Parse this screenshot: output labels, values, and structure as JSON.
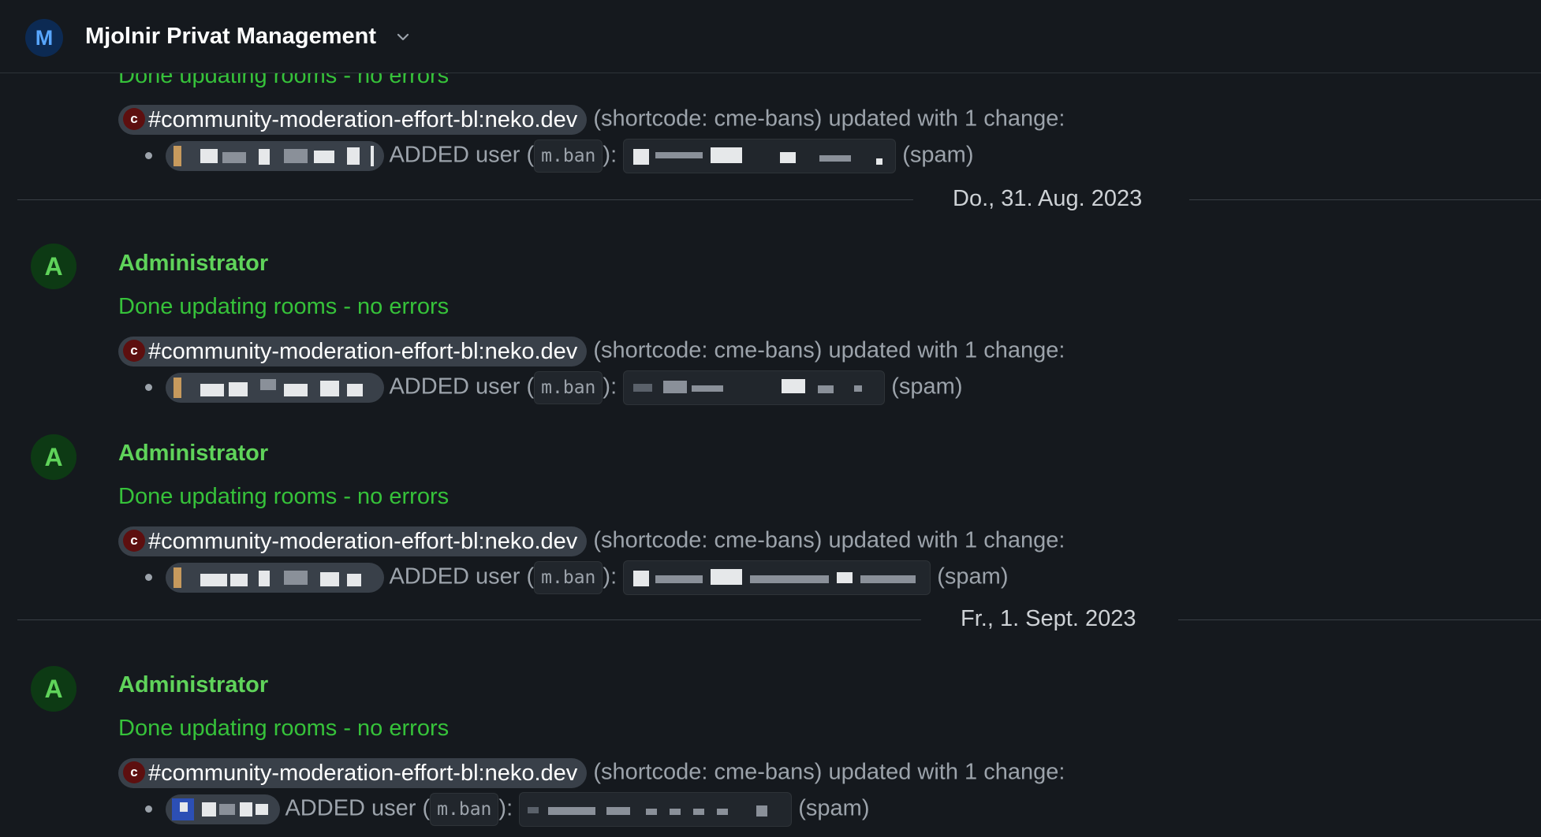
{
  "header": {
    "room_avatar_letter": "M",
    "room_name": "Mjolnir Privat Management",
    "dropdown_icon": "chevron-down-icon"
  },
  "colors": {
    "background": "#15191e",
    "sender_green": "#5fd35a",
    "notice_green": "#36c23a",
    "pill_bg": "#394049",
    "room_icon_red": "#5d0f0f"
  },
  "common": {
    "sender": "Administrator",
    "avatar_letter": "A",
    "notice": "Done updating rooms - no errors",
    "notice_partial": "Done updating rooms - no errors",
    "room_icon_letter": "c",
    "room_alias": "#community-moderation-effort-bl:neko.dev",
    "update_text": "(shortcode: cme-bans) updated with 1 change:",
    "added_user": "ADDED user (",
    "code": "m.ban",
    "close": "):",
    "reason": "(spam)"
  },
  "separators": [
    {
      "date": "Do., 31. Aug. 2023"
    },
    {
      "date": "Fr., 1. Sept. 2023"
    }
  ]
}
